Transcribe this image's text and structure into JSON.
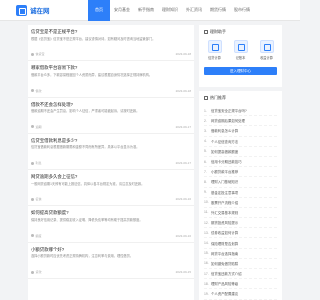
{
  "site": {
    "logo_text": "诚在网"
  },
  "nav": [
    {
      "label": "首页",
      "active": true
    },
    {
      "label": "安月基金",
      "active": false
    },
    {
      "label": "新手指南",
      "active": false
    },
    {
      "label": "理财知识",
      "active": false
    },
    {
      "label": "外汇资讯",
      "active": false
    },
    {
      "label": "期货行情",
      "active": false
    },
    {
      "label": "股市行情",
      "active": false
    }
  ],
  "articles": [
    {
      "title": "信贷宝是不是正规平台?",
      "body": "根据《信贷宝》信贷宝不是正规平台，建议谨慎对待，如有疑问及时咨询当地监管部门。",
      "author": "信贷宝",
      "date": "2023-09-18"
    },
    {
      "title": "哪家借款平台容易下款?",
      "body": "借款平台众多，下款容易程度因个人资质而异，建议根据自身情况选择正规持牌机构。",
      "author": "借款",
      "date": "2023-09-18"
    },
    {
      "title": "借款不还会怎样处理?",
      "body": "借款逾期不还会产生罚息，影响个人征信，严重者可能被起诉，请按时还款。",
      "author": "逾期",
      "date": "2023-09-17"
    },
    {
      "title": "信贷宝借款利息是多少?",
      "body": "信贷宝借款利息根据借款期限和金额不同而有所差异，具体以平台显示为准。",
      "author": "利息",
      "date": "2023-09-17"
    },
    {
      "title": "网贷逾期多久会上征信?",
      "body": "一般网贷逾期1天即有可能上报征信，具体以各平台规定为准，请注意及时还款。",
      "author": "征信",
      "date": "2023-09-16"
    },
    {
      "title": "如何提高贷款额度?",
      "body": "保持良好信用记录、提供稳定收入证明、降低负债率等均有助于提高贷款额度。",
      "author": "额度",
      "date": "2023-09-16"
    },
    {
      "title": "小额贷款哪个好?",
      "body": "选择小额贷款时应优先考虑正规持牌机构，注意利率与费用，理性借贷。",
      "author": "贷款",
      "date": "2023-09-15"
    }
  ],
  "tools_card": {
    "title": "理财助手",
    "items": [
      {
        "label": "信贷计算"
      },
      {
        "label": "记账本"
      },
      {
        "label": "收益计算"
      }
    ],
    "cta": "进入理财中心"
  },
  "rank_card": {
    "title": "热门推荐",
    "items": [
      {
        "num": "1.",
        "label": "信贷宝安全正规平台吗?"
      },
      {
        "num": "2.",
        "label": "网贷逾期后果如何处理"
      },
      {
        "num": "3.",
        "label": "借款利息怎么计算"
      },
      {
        "num": "4.",
        "label": "个人征信查询方法"
      },
      {
        "num": "5.",
        "label": "如何提高借款额度"
      },
      {
        "num": "6.",
        "label": "信用卡分期还款技巧"
      },
      {
        "num": "7.",
        "label": "小额贷款平台推荐"
      },
      {
        "num": "8.",
        "label": "理财入门基础知识"
      },
      {
        "num": "9.",
        "label": "基金定投注意事项"
      },
      {
        "num": "10.",
        "label": "股票开户流程介绍"
      },
      {
        "num": "11.",
        "label": "外汇交易基本规则"
      },
      {
        "num": "12.",
        "label": "期货投资风险提示"
      },
      {
        "num": "13.",
        "label": "债券收益如何计算"
      },
      {
        "num": "14.",
        "label": "保险理财是否划算"
      },
      {
        "num": "15.",
        "label": "网贷平台选择指南"
      },
      {
        "num": "16.",
        "label": "如何避免借贷陷阱"
      },
      {
        "num": "17.",
        "label": "信贷宝还款方式介绍"
      },
      {
        "num": "18.",
        "label": "理财产品风险等级"
      },
      {
        "num": "19.",
        "label": "个人资产配置建议"
      }
    ]
  }
}
